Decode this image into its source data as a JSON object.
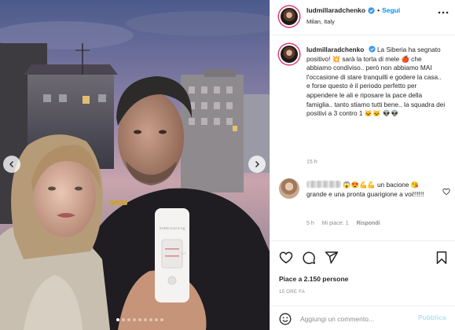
{
  "post": {
    "username": "ludmillaradchenko",
    "separator": "•",
    "follow_label": "Segui",
    "location": "Milan, Italy",
    "caption": {
      "username": "ludmillaradchenko",
      "text": "La Siberia ha segnato positivo! 💥 sarà la torta di mele 🍎 che abbiamo condiviso.. però non abbiamo MAI l'occasione di stare tranquilli e godere la casa.. e forse questo è il periodo perfetto per appendere le ali e riposare la pace della famiglia.. tanto stiamo tutti bene.. la squadra dei positivi a 3 contro 1 🐱🐱 👽👽",
      "time": "15 h"
    },
    "comment": {
      "text": "😱😍💪💪 un bacione 😘 grande e una pronta guarigione a voi!!!!!!",
      "time": "5 h",
      "likes": "Mi piace: 1",
      "reply_label": "Rispondi"
    },
    "likes_text": "Piace a 2.150 persone",
    "posted_ago": "15 ORE FA",
    "add_comment_placeholder": "Aggiungi un commento...",
    "publish_label": "Pubblica"
  },
  "photo": {
    "test_label": "SARS-CoV-2 Ag",
    "test_marks": "C  T",
    "carousel_total": 9,
    "carousel_active": 0
  },
  "colors": {
    "accent": "#0095f6",
    "publish_disabled": "#b2dffc",
    "verified": "#3897f0"
  },
  "icons": [
    "chevron-left-icon",
    "chevron-right-icon",
    "verified-badge-icon",
    "more-options-icon",
    "heart-icon",
    "comment-icon",
    "share-icon",
    "bookmark-icon",
    "emoji-icon"
  ]
}
